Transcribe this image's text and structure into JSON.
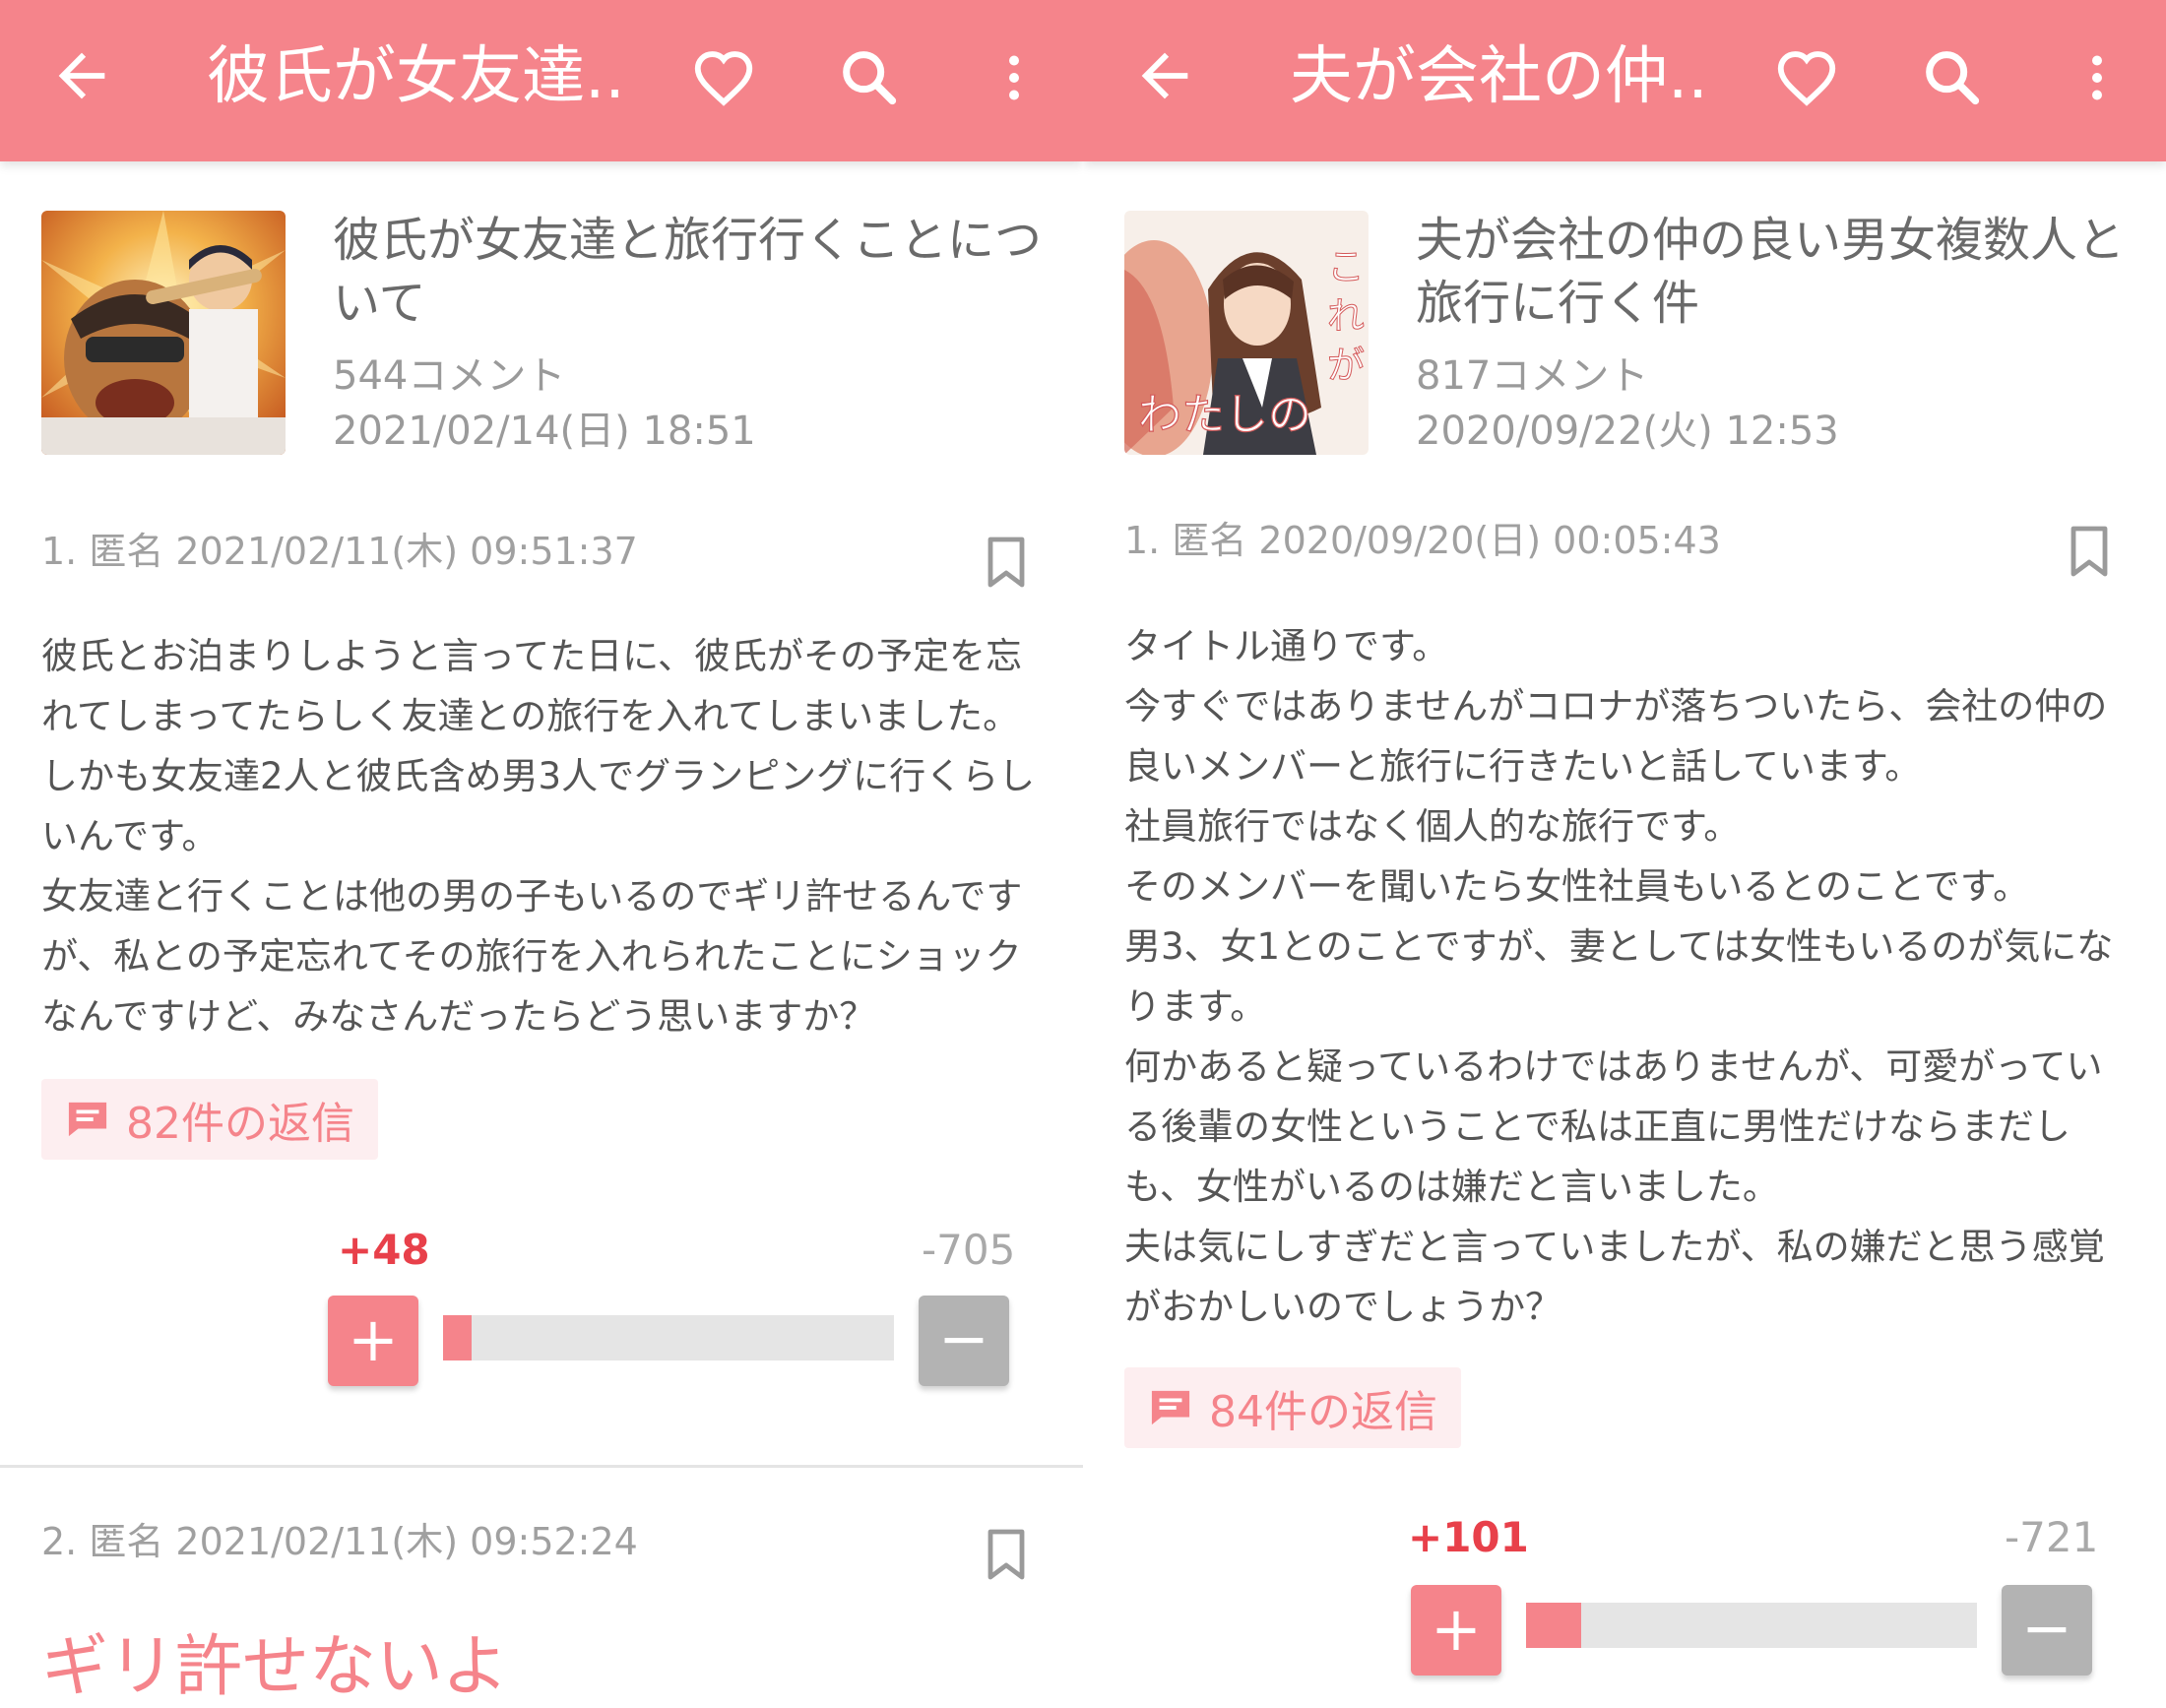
{
  "colors": {
    "accent": "#f5848b",
    "plus_number": "#e8404a",
    "minus_button": "#b3b3b3"
  },
  "left": {
    "appbar": {
      "title": "彼氏が女友達...",
      "icons": [
        "arrow-left-icon",
        "heart-icon",
        "search-icon",
        "more-vert-icon"
      ]
    },
    "topic": {
      "title": "彼氏が女友達と旅行行くことについて",
      "title_line1": "彼氏が女友達と旅行行くことにつ",
      "title_line2": "いて",
      "comments": "544コメント",
      "date": "2021/02/14(日) 18:51"
    },
    "posts": [
      {
        "header": "1. 匿名 2021/02/11(木) 09:51:37",
        "body_lines": [
          "彼氏とお泊まりしようと言ってた日に、彼氏がその予定を忘",
          "れてしまってたらしく友達との旅行を入れてしまいました。",
          "しかも女友達2人と彼氏含め男3人でグランピングに行くらし",
          "いんです。",
          "女友達と行くことは他の男の子もいるのでギリ許せるんです",
          "が、私との予定忘れてその旅行を入れられたことにショック",
          "なんですけど、みなさんだったらどう思いますか？"
        ],
        "replies": "82件の返信",
        "plus": "+48",
        "minus": "-705",
        "plus_ratio": 0.064
      },
      {
        "header": "2. 匿名 2021/02/11(木) 09:52:24",
        "body": "ギリ許せないよ"
      }
    ]
  },
  "right": {
    "appbar": {
      "title": "夫が会社の仲...",
      "icons": [
        "arrow-left-icon",
        "heart-icon",
        "search-icon",
        "more-vert-icon"
      ]
    },
    "topic": {
      "title": "夫が会社の仲の良い男女複数人と旅行に行く件",
      "title_line1": "夫が会社の仲の良い男女複数人と",
      "title_line2": "旅行に行く件",
      "comments": "817コメント",
      "date": "2020/09/22(火) 12:53",
      "thumb_text": "これが わたしの"
    },
    "posts": [
      {
        "header": "1. 匿名 2020/09/20(日) 00:05:43",
        "body_lines": [
          "タイトル通りです。",
          "今すぐではありませんがコロナが落ちついたら、会社の仲の",
          "良いメンバーと旅行に行きたいと話しています。",
          "社員旅行ではなく個人的な旅行です。",
          "そのメンバーを聞いたら女性社員もいるとのことです。",
          "男3、女1とのことですが、妻としては女性もいるのが気にな",
          "ります。",
          "何かあると疑っているわけではありませんが、可愛がってい",
          "る後輩の女性ということで私は正直に男性だけならまだし",
          "も、女性がいるのは嫌だと言いました。",
          "夫は気にしすぎだと言っていましたが、私の嫌だと思う感覚",
          "がおかしいのでしょうか？"
        ],
        "replies": "84件の返信",
        "plus": "+101",
        "minus": "-721",
        "plus_ratio": 0.123
      }
    ]
  }
}
